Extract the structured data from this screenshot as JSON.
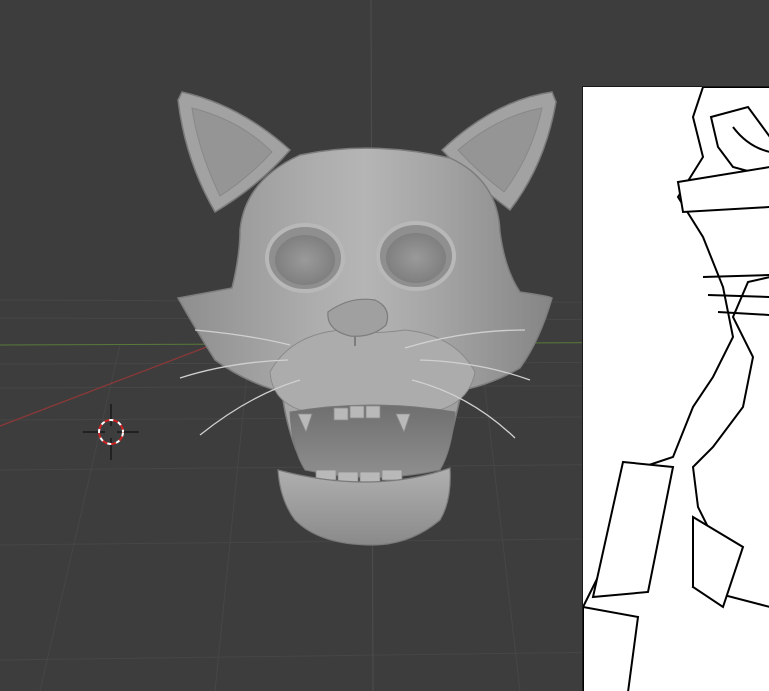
{
  "viewport": {
    "background_color": "#3d3d3d",
    "grid_color": "#474747",
    "x_axis_color": "#8a3838",
    "y_axis_color": "#5a7a3a",
    "z_axis_color": "#4d4d4d",
    "model_color": "#a6a6a6",
    "reference_panel_color": "#ffffff"
  },
  "icons": {
    "cursor": "3d-cursor-icon"
  }
}
